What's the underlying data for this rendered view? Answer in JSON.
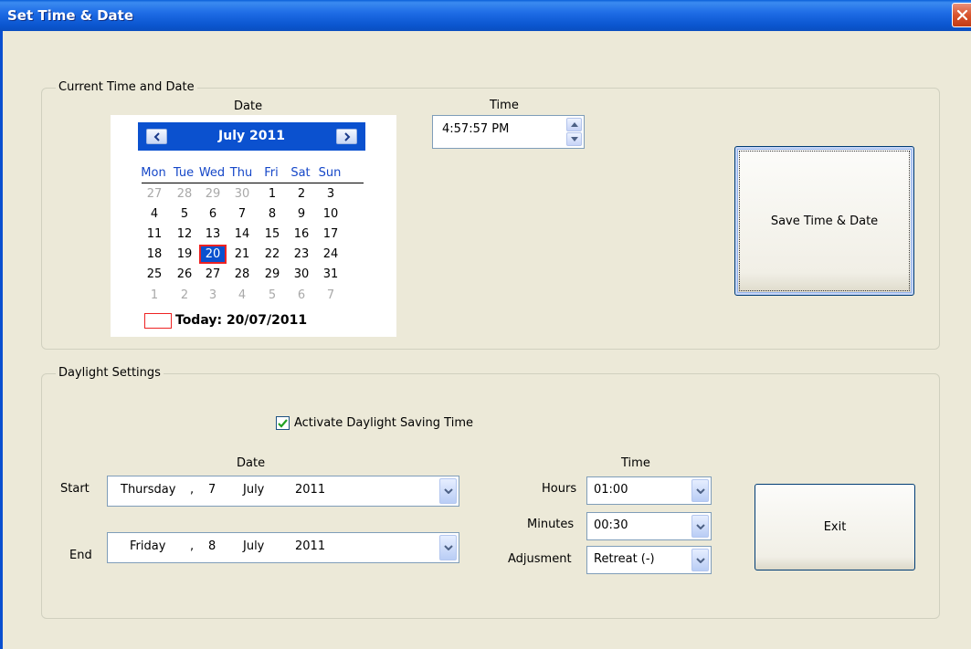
{
  "window": {
    "title": "Set Time & Date"
  },
  "current": {
    "group_label": "Current Time and Date",
    "date_label": "Date",
    "time_label": "Time",
    "time_value": "4:57:57 PM",
    "save_button": "Save Time & Date",
    "calendar": {
      "month_label": "July 2011",
      "weekdays": [
        "Mon",
        "Tue",
        "Wed",
        "Thu",
        "Fri",
        "Sat",
        "Sun"
      ],
      "weeks": [
        [
          "27",
          "28",
          "29",
          "30",
          "1",
          "2",
          "3"
        ],
        [
          "4",
          "5",
          "6",
          "7",
          "8",
          "9",
          "10"
        ],
        [
          "11",
          "12",
          "13",
          "14",
          "15",
          "16",
          "17"
        ],
        [
          "18",
          "19",
          "20",
          "21",
          "22",
          "23",
          "24"
        ],
        [
          "25",
          "26",
          "27",
          "28",
          "29",
          "30",
          "31"
        ],
        [
          "1",
          "2",
          "3",
          "4",
          "5",
          "6",
          "7"
        ]
      ],
      "selected_day": "20",
      "today_text": "Today: 20/07/2011"
    }
  },
  "daylight": {
    "group_label": "Daylight Settings",
    "checkbox_label": "Activate Daylight Saving Time",
    "checkbox_checked": true,
    "date_label": "Date",
    "time_label": "Time",
    "start_label": "Start",
    "end_label": "End",
    "start": {
      "weekday": "Thursday",
      "sep": ",",
      "day": "7",
      "month": "July",
      "year": "2011"
    },
    "end": {
      "weekday": "Friday",
      "sep": ",",
      "day": "8",
      "month": "July",
      "year": "2011"
    },
    "hours_label": "Hours",
    "hours_value": "01:00",
    "minutes_label": "Minutes",
    "minutes_value": "00:30",
    "adjustment_label": "Adjusment",
    "adjustment_value": "Retreat (-)",
    "exit_button": "Exit"
  },
  "colors": {
    "titlebar": "#0b56d0",
    "calendar_header": "#0b51cf",
    "selected_border": "#ee2222",
    "weekday_text": "#1547c8"
  }
}
